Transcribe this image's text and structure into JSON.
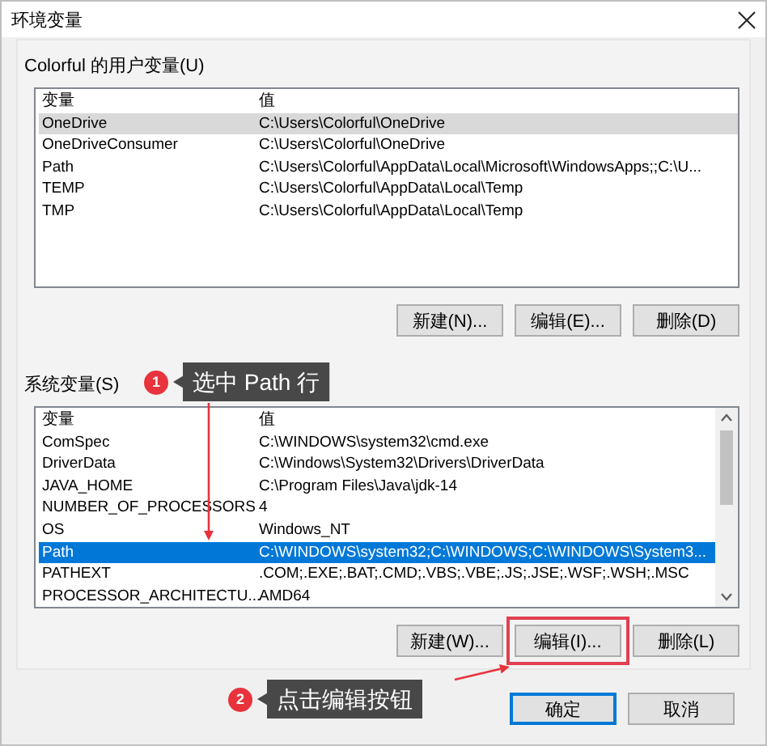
{
  "window": {
    "title": "环境变量"
  },
  "user_vars": {
    "label": "Colorful 的用户变量(U)",
    "focused": false,
    "columns": [
      "变量",
      "值"
    ],
    "rows": [
      {
        "name": "OneDrive",
        "value": "C:\\Users\\Colorful\\OneDrive",
        "selected": true
      },
      {
        "name": "OneDriveConsumer",
        "value": "C:\\Users\\Colorful\\OneDrive",
        "selected": false
      },
      {
        "name": "Path",
        "value": "C:\\Users\\Colorful\\AppData\\Local\\Microsoft\\WindowsApps;;C:\\U...",
        "selected": false
      },
      {
        "name": "TEMP",
        "value": "C:\\Users\\Colorful\\AppData\\Local\\Temp",
        "selected": false
      },
      {
        "name": "TMP",
        "value": "C:\\Users\\Colorful\\AppData\\Local\\Temp",
        "selected": false
      }
    ],
    "buttons": [
      {
        "label": "新建(N)...",
        "highlighted": false
      },
      {
        "label": "编辑(E)...",
        "highlighted": false
      },
      {
        "label": "删除(D)",
        "highlighted": false
      }
    ]
  },
  "system_vars": {
    "label": "系统变量(S)",
    "focused": true,
    "columns": [
      "变量",
      "值"
    ],
    "rows": [
      {
        "name": "ComSpec",
        "value": "C:\\WINDOWS\\system32\\cmd.exe",
        "selected": false
      },
      {
        "name": "DriverData",
        "value": "C:\\Windows\\System32\\Drivers\\DriverData",
        "selected": false
      },
      {
        "name": "JAVA_HOME",
        "value": "C:\\Program Files\\Java\\jdk-14",
        "selected": false
      },
      {
        "name": "NUMBER_OF_PROCESSORS",
        "value": "4",
        "selected": false
      },
      {
        "name": "OS",
        "value": "Windows_NT",
        "selected": false
      },
      {
        "name": "Path",
        "value": "C:\\WINDOWS\\system32;C:\\WINDOWS;C:\\WINDOWS\\System3...",
        "selected": true
      },
      {
        "name": "PATHEXT",
        "value": ".COM;.EXE;.BAT;.CMD;.VBS;.VBE;.JS;.JSE;.WSF;.WSH;.MSC",
        "selected": false
      },
      {
        "name": "PROCESSOR_ARCHITECTU...",
        "value": "AMD64",
        "selected": false
      }
    ],
    "buttons": [
      {
        "label": "新建(W)...",
        "highlighted": false
      },
      {
        "label": "编辑(I)...",
        "highlighted": true
      },
      {
        "label": "删除(L)",
        "highlighted": false
      }
    ]
  },
  "dialog_buttons": [
    {
      "label": "确定",
      "default": true
    },
    {
      "label": "取消",
      "default": false
    }
  ],
  "callouts": [
    {
      "number": "1",
      "text": "选中 Path 行"
    },
    {
      "number": "2",
      "text": "点击编辑按钮"
    }
  ]
}
